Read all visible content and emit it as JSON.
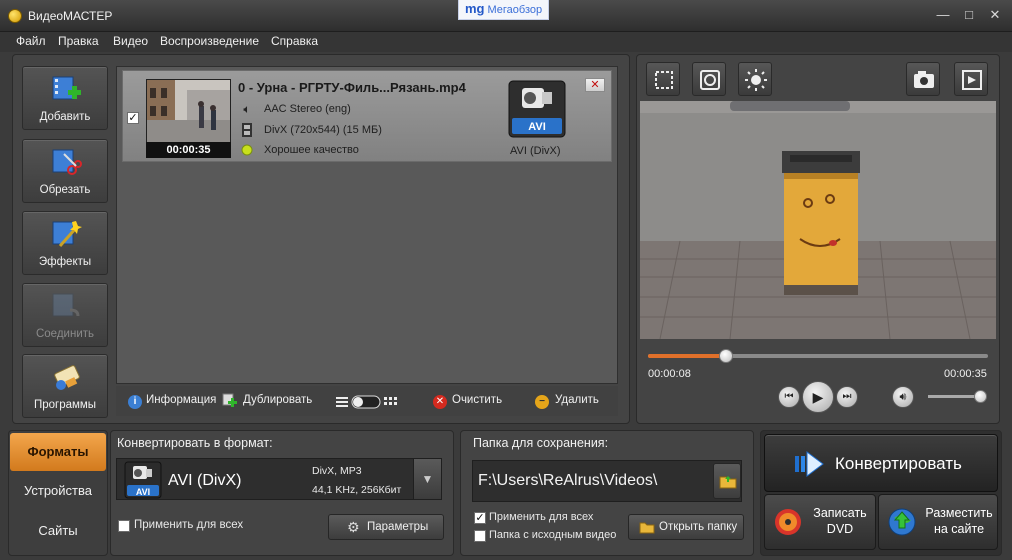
{
  "window": {
    "title": "ВидеоМАСТЕР",
    "watermark_logo": "mg",
    "watermark_text": "Мегаобзор",
    "controls": [
      "—",
      "□",
      "✕"
    ]
  },
  "menu": [
    "Файл",
    "Правка",
    "Видео",
    "Воспроизведение",
    "Справка"
  ],
  "tools": [
    {
      "label": "Добавить",
      "icon": "add-video-icon",
      "enabled": true
    },
    {
      "label": "Обрезать",
      "icon": "cut-icon",
      "enabled": true
    },
    {
      "label": "Эффекты",
      "icon": "effects-icon",
      "enabled": true
    },
    {
      "label": "Соединить",
      "icon": "join-icon",
      "enabled": false
    },
    {
      "label": "Программы",
      "icon": "programs-icon",
      "enabled": true
    }
  ],
  "file": {
    "checked": true,
    "name": "0 - Урна - РГРТУ-Филь...Рязань.mp4",
    "duration": "00:00:35",
    "audio": "AAC Stereo (eng)",
    "video": "DivX (720x544) (15 МБ)",
    "quality": "Хорошее качество",
    "format_badge": "AVI",
    "format_caption": "AVI (DivX)"
  },
  "list_toolbar": {
    "info": "Информация",
    "duplicate": "Дублировать",
    "clear": "Очистить",
    "delete": "Удалить"
  },
  "player": {
    "current_time": "00:00:08",
    "total_time": "00:00:35",
    "progress": 0.23,
    "volume": 0.9
  },
  "tabs": [
    {
      "label": "Форматы",
      "active": true
    },
    {
      "label": "Устройства",
      "active": false
    },
    {
      "label": "Сайты",
      "active": false
    }
  ],
  "convert_format": {
    "title": "Конвертировать в формат:",
    "badge": "AVI",
    "name": "AVI (DivX)",
    "codecs": "DivX, MP3",
    "audio_params": "44,1 KHz, 256Кбит",
    "apply_all": "Применить для всех",
    "params_button": "Параметры"
  },
  "save": {
    "title": "Папка для сохранения:",
    "path": "F:\\Users\\ReAlrus\\Videos\\",
    "apply_all": "Применить для всех",
    "apply_all_checked": true,
    "source_folder": "Папка с исходным видео",
    "source_folder_checked": false,
    "open_folder": "Открыть папку"
  },
  "actions": {
    "convert": "Конвертировать",
    "burn_line1": "Записать",
    "burn_line2": "DVD",
    "publish_line1": "Разместить",
    "publish_line2": "на сайте"
  },
  "colors": {
    "accent_orange": "#e0702a",
    "active_tab": "#f3a64c"
  }
}
